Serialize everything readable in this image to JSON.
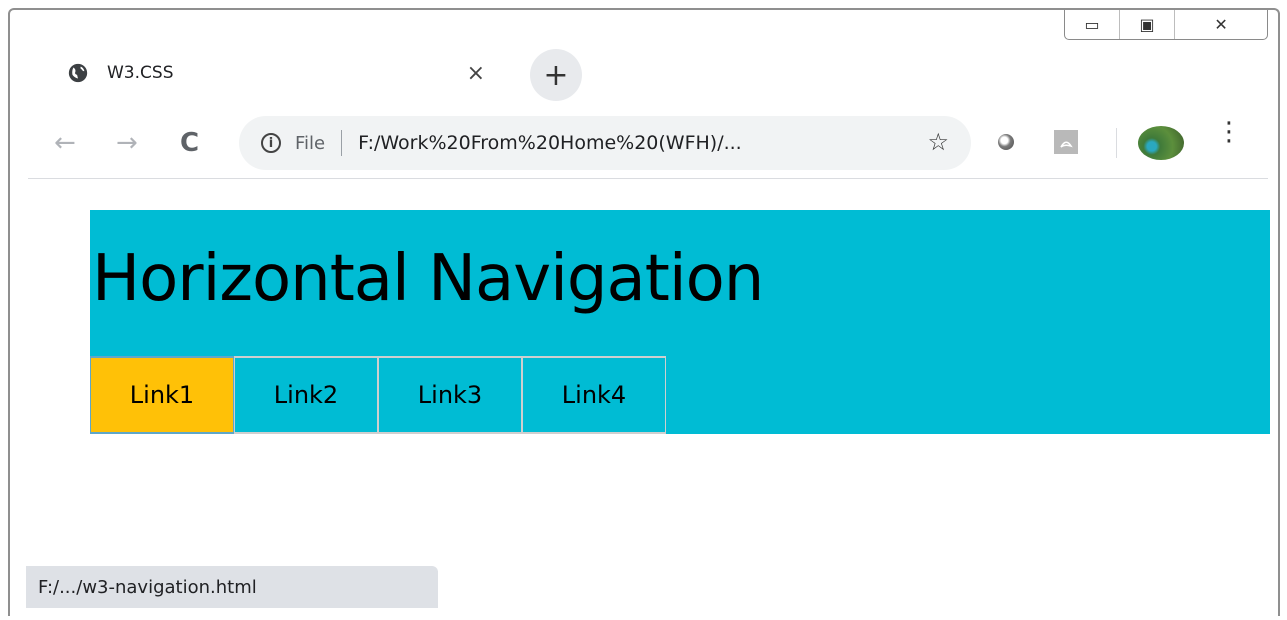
{
  "browser": {
    "tab_title": "W3.CSS",
    "tab_close": "×",
    "new_tab": "+",
    "window_controls": {
      "minimize": "▭",
      "maximize": "▣",
      "close": "✕"
    },
    "toolbar": {
      "back": "←",
      "forward": "→",
      "reload": "C",
      "info": "i",
      "file_label": "File",
      "url": "F:/Work%20From%20Home%20(WFH)/...",
      "star": "☆",
      "menu": "⋮"
    },
    "status_url": "F:/.../w3-navigation.html"
  },
  "page": {
    "title": "Horizontal Navigation",
    "nav_links": [
      "Link1",
      "Link2",
      "Link3",
      "Link4"
    ],
    "active_link": "Link1"
  },
  "colors": {
    "header_bg": "#00bcd4",
    "active_link_bg": "#ffc107"
  },
  "icons": [
    "globe-icon",
    "close-icon",
    "plus-icon",
    "back-arrow-icon",
    "forward-arrow-icon",
    "reload-icon",
    "info-icon",
    "star-icon",
    "extension-icon",
    "pdf-extension-icon",
    "avatar",
    "menu-kebab-icon",
    "minimize-icon",
    "maximize-icon",
    "window-close-icon"
  ]
}
